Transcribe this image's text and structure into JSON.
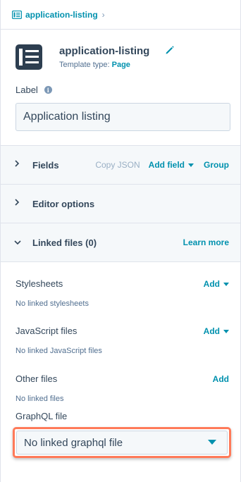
{
  "breadcrumb": {
    "label": "application-listing",
    "chevron": "›",
    "icon": "module-icon"
  },
  "header": {
    "title": "application-listing",
    "template_type_label": "Template type:",
    "template_type_value": "Page",
    "edit_icon": "pencil-icon"
  },
  "label_field": {
    "label": "Label",
    "info": "i",
    "value": "Application listing"
  },
  "sections": {
    "fields": {
      "title": "Fields",
      "copy_json": "Copy JSON",
      "add_field": "Add field",
      "group": "Group"
    },
    "editor_options": {
      "title": "Editor options"
    },
    "linked_files": {
      "title": "Linked files (0)",
      "learn_more": "Learn more"
    }
  },
  "linked": {
    "stylesheets": {
      "title": "Stylesheets",
      "add": "Add",
      "empty": "No linked stylesheets"
    },
    "javascript": {
      "title": "JavaScript files",
      "add": "Add",
      "empty": "No linked JavaScript files"
    },
    "other": {
      "title": "Other files",
      "add": "Add",
      "empty": "No linked files"
    },
    "graphql": {
      "title": "GraphQL file",
      "selected": "No linked graphql file"
    }
  },
  "colors": {
    "accent": "#0091ae",
    "text": "#33475b",
    "highlight": "#ff7a59",
    "muted": "#99afc4"
  }
}
